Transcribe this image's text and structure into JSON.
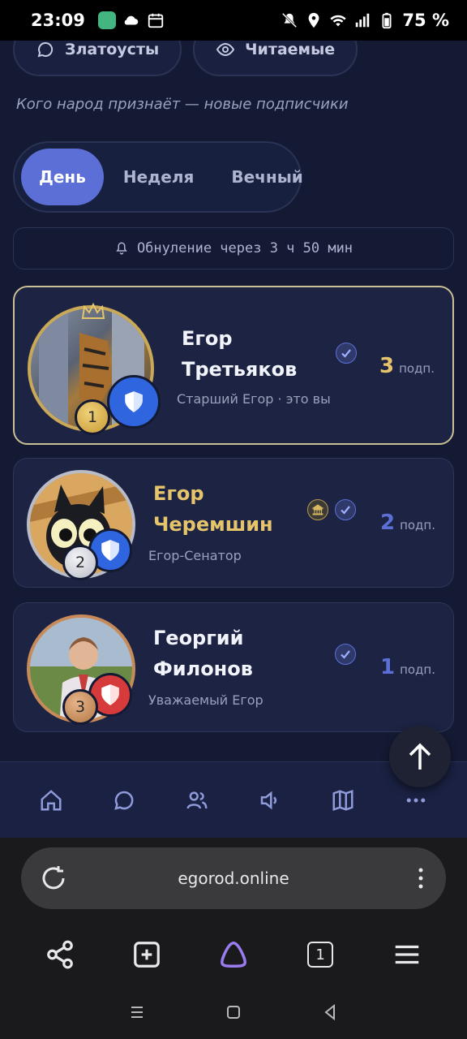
{
  "status_bar": {
    "time": "23:09",
    "battery": "75 %"
  },
  "top_chips": [
    {
      "label": "Златоусты",
      "icon": "chat-bubble-icon"
    },
    {
      "label": "Читаемые",
      "icon": "eye-icon"
    }
  ],
  "subtitle": "Кого народ признаёт — новые подписчики",
  "period_tabs": [
    {
      "label": "День",
      "active": true
    },
    {
      "label": "Неделя",
      "active": false
    },
    {
      "label": "Вечный",
      "active": false
    }
  ],
  "reset_notice": "Обнуление через 3 ч 50 мин",
  "leaders": [
    {
      "rank": "1",
      "name_line1": "Егор",
      "name_line2": "Третьяков",
      "role": "Старший Егор · это вы",
      "subs": "3",
      "subs_unit": "подп.",
      "shield_color": "#2f66e0",
      "highlight": true
    },
    {
      "rank": "2",
      "name_line1": "Егор",
      "name_line2": "Черемшин",
      "role": "Егор-Сенатор",
      "subs": "2",
      "subs_unit": "подп.",
      "shield_color": "#2f66e0",
      "highlight": false
    },
    {
      "rank": "3",
      "name_line1": "Георгий",
      "name_line2": "Филонов",
      "role": "Уважаемый Егор",
      "subs": "1",
      "subs_unit": "подп.",
      "shield_color": "#d63a3a",
      "highlight": false
    }
  ],
  "site_nav": [
    "home-icon",
    "chat-icon",
    "users-icon",
    "speaker-icon",
    "map-icon",
    "more-icon"
  ],
  "browser": {
    "url": "egorod.online",
    "tab_count": "1"
  }
}
